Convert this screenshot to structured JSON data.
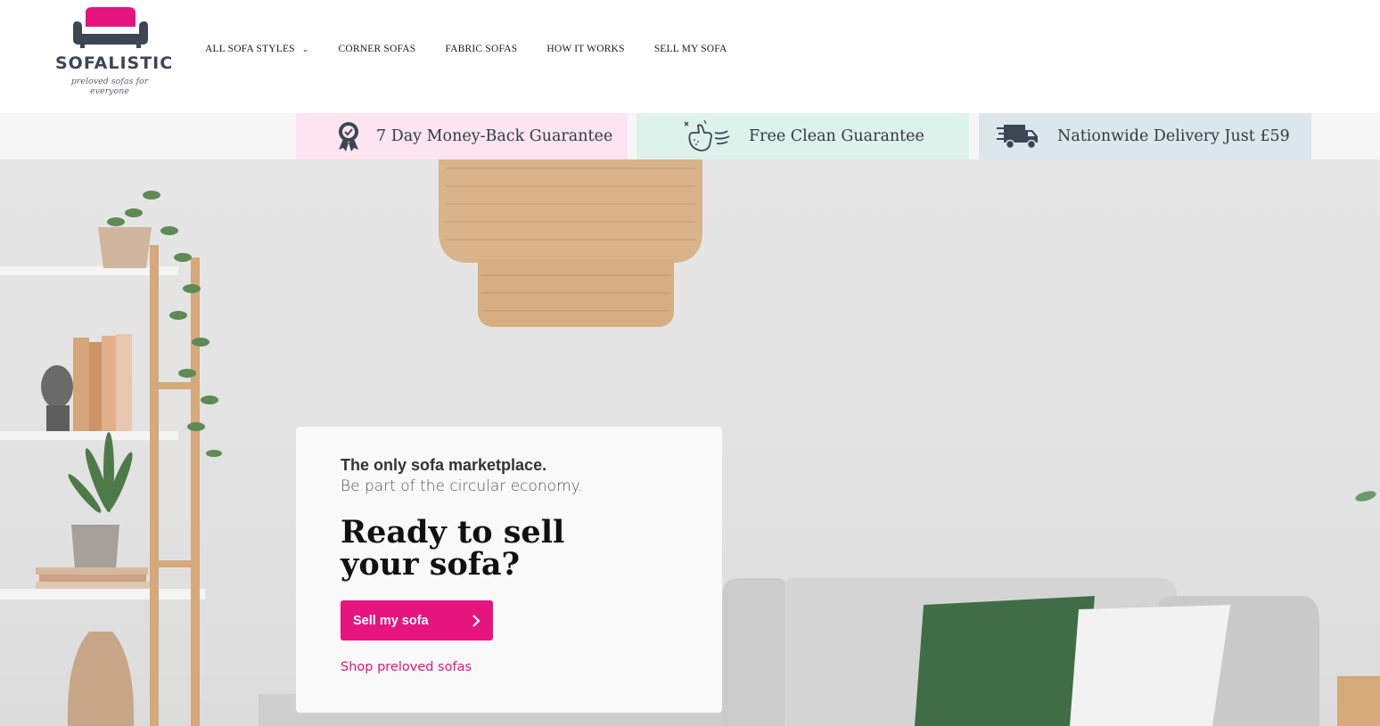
{
  "brand": {
    "name": "SOFALISTIC",
    "tagline": "preloved sofas for everyone",
    "accent_color": "#e5147f",
    "text_color": "#3d4654"
  },
  "nav": {
    "items": [
      {
        "label": "ALL SOFA STYLES",
        "has_dropdown": true
      },
      {
        "label": "CORNER SOFAS"
      },
      {
        "label": "FABRIC SOFAS"
      },
      {
        "label": "HOW IT WORKS"
      },
      {
        "label": "SELL MY SOFA"
      }
    ]
  },
  "guarantees": [
    {
      "label": "7 Day Money-Back Guarantee",
      "icon": "award-ribbon-icon",
      "color": "#fce4f1"
    },
    {
      "label": "Free Clean Guarantee",
      "icon": "clean-hand-icon",
      "color": "#dcf2ea"
    },
    {
      "label": "Nationwide Delivery Just £59",
      "icon": "delivery-truck-icon",
      "color": "#dce7eb"
    }
  ],
  "hero": {
    "tagline": "The only sofa marketplace.",
    "subtitle": "Be part of the circular economy.",
    "title": "Ready to sell your sofa?",
    "cta_label": "Sell my sofa",
    "cta_icon": "chevron-right-icon",
    "secondary_link": "Shop preloved sofas"
  }
}
